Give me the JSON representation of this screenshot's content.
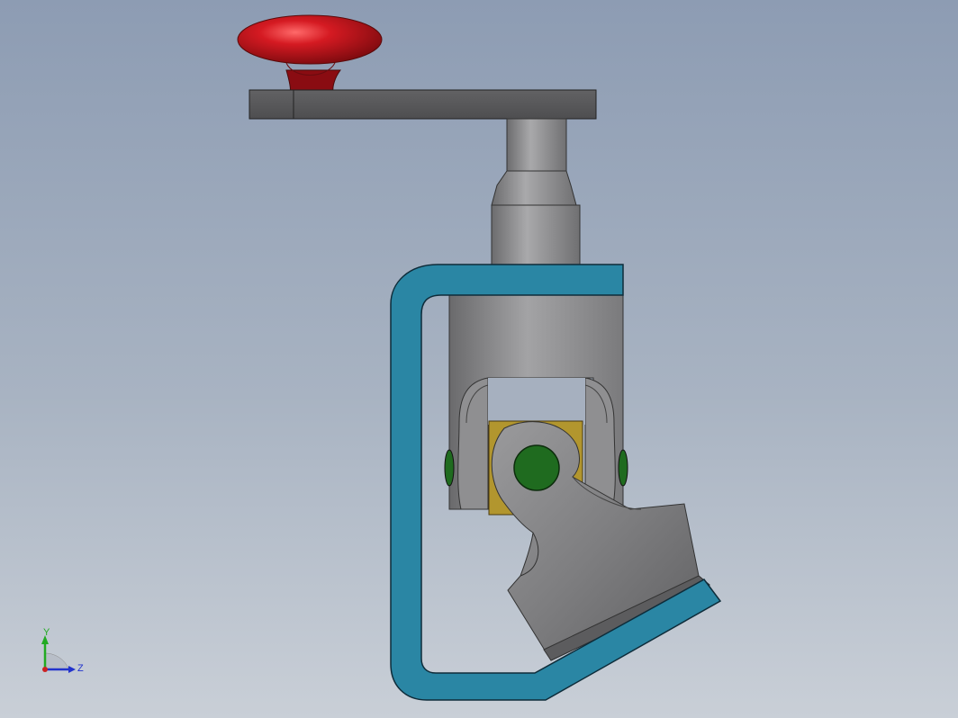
{
  "viewport": {
    "background_top": "#8d9cb3",
    "background_bottom": "#c9cfd7"
  },
  "model": {
    "parts": [
      "handle-knob",
      "crank-arm",
      "input-shaft",
      "u-joint-yoke-upper",
      "cross-spider-block",
      "cross-pin",
      "u-joint-yoke-lower",
      "c-frame-bracket"
    ],
    "colors": {
      "knob": "#c0121a",
      "arm": "#5a5a5c",
      "shaft": "#8e8e90",
      "bracket": "#2a86a4",
      "spider": "#b2962e",
      "pin": "#1f6b1f"
    }
  },
  "triad": {
    "y_label": "Y",
    "z_label": "Z",
    "y_color": "#22aa22",
    "z_color": "#2233cc",
    "x_color": "#cc2222"
  }
}
